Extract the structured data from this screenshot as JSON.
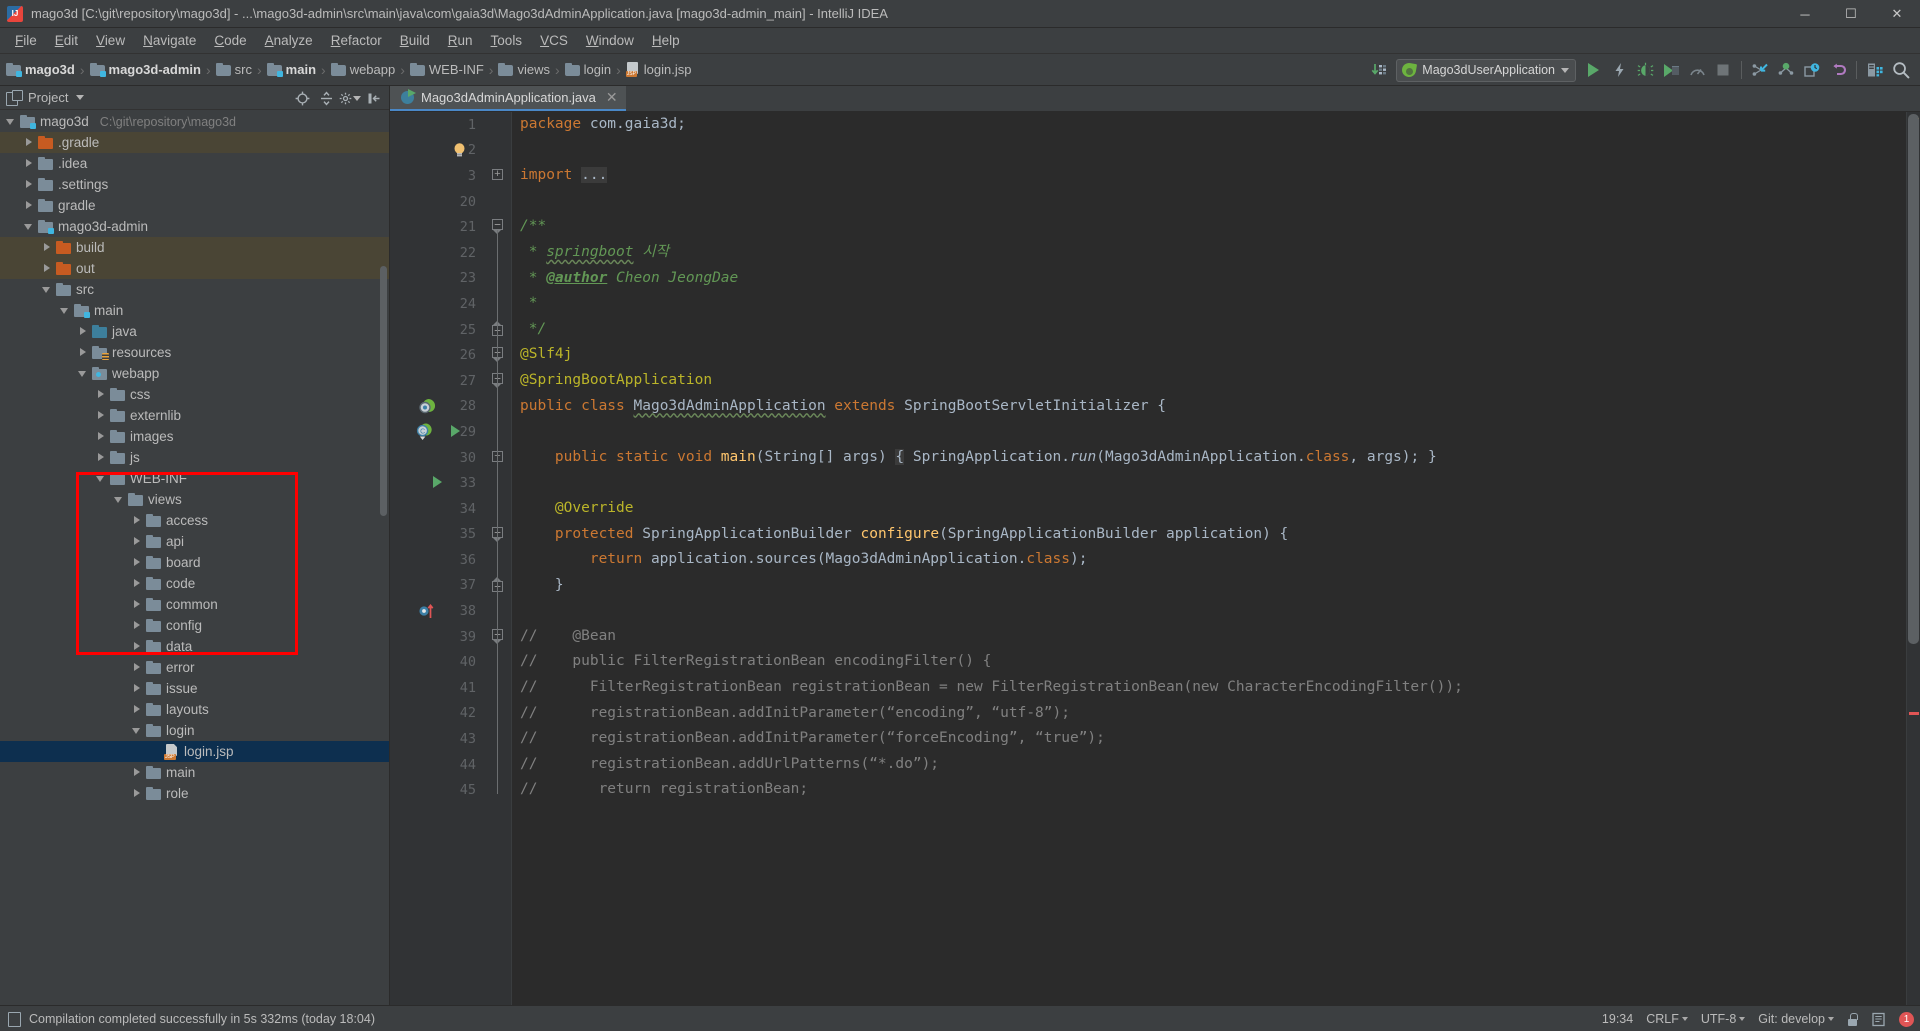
{
  "window": {
    "title": "mago3d [C:\\git\\repository\\mago3d] - ...\\mago3d-admin\\src\\main\\java\\com\\gaia3d\\Mago3dAdminApplication.java [mago3d-admin_main] - IntelliJ IDEA",
    "app_icon": "intellij-idea-icon",
    "minimize_label": "─",
    "maximize_label": "☐",
    "close_label": "✕"
  },
  "menubar": {
    "items": [
      {
        "label": "File"
      },
      {
        "label": "Edit"
      },
      {
        "label": "View"
      },
      {
        "label": "Navigate"
      },
      {
        "label": "Code"
      },
      {
        "label": "Analyze"
      },
      {
        "label": "Refactor"
      },
      {
        "label": "Build"
      },
      {
        "label": "Run"
      },
      {
        "label": "Tools"
      },
      {
        "label": "VCS"
      },
      {
        "label": "Window"
      },
      {
        "label": "Help"
      }
    ]
  },
  "navbar": {
    "breadcrumbs": [
      {
        "label": "mago3d",
        "icon": "module-folder-icon",
        "bold": true
      },
      {
        "label": "mago3d-admin",
        "icon": "module-folder-icon",
        "bold": true
      },
      {
        "label": "src",
        "icon": "folder-icon",
        "bold": false
      },
      {
        "label": "main",
        "icon": "module-folder-icon",
        "bold": true
      },
      {
        "label": "webapp",
        "icon": "web-folder-icon",
        "bold": false
      },
      {
        "label": "WEB-INF",
        "icon": "folder-icon",
        "bold": false
      },
      {
        "label": "views",
        "icon": "folder-icon",
        "bold": false
      },
      {
        "label": "login",
        "icon": "folder-icon",
        "bold": false
      },
      {
        "label": "login.jsp",
        "icon": "jsp-file-icon",
        "bold": false
      }
    ],
    "separator": "›",
    "run_config": {
      "label": "Mago3dUserApplication",
      "icon": "spring-leaf-icon",
      "dropdown_icon": "chevron-down-icon"
    },
    "actions": [
      {
        "name": "update-project-icon",
        "glyph": "↓"
      },
      {
        "name": "run-icon",
        "glyph": "▶"
      },
      {
        "name": "run-with-coverage-icon",
        "glyph": "⚡"
      },
      {
        "name": "debug-icon",
        "glyph": "🐞"
      },
      {
        "name": "run-coverage-icon",
        "glyph": "▶"
      },
      {
        "name": "profiler-icon",
        "glyph": "◔"
      },
      {
        "name": "stop-icon",
        "glyph": "■"
      },
      {
        "name": "vcs-update-icon",
        "glyph": "↙"
      },
      {
        "name": "vcs-commit-icon",
        "glyph": "✔"
      },
      {
        "name": "vcs-history-icon",
        "glyph": "◴"
      },
      {
        "name": "vcs-rollback-icon",
        "glyph": "↶"
      },
      {
        "name": "structure-icon",
        "glyph": "☷"
      },
      {
        "name": "search-everywhere-icon",
        "glyph": "🔍"
      }
    ]
  },
  "project_panel": {
    "title": "Project",
    "dropdown_icon": "chevron-down-icon",
    "header_actions": [
      {
        "name": "locate-file-icon",
        "glyph": "⊕"
      },
      {
        "name": "collapse-all-icon",
        "glyph": "⤓"
      },
      {
        "name": "settings-icon",
        "glyph": "⚙"
      },
      {
        "name": "hide-panel-icon",
        "glyph": "⇤"
      }
    ],
    "tree": [
      {
        "label": "mago3d",
        "path": "C:\\git\\repository\\mago3d",
        "indent": 0,
        "state": "open",
        "icon": "module-folder-icon",
        "style": "normal"
      },
      {
        "label": ".gradle",
        "indent": 1,
        "state": "closed",
        "icon": "excluded-folder-icon",
        "style": "excluded"
      },
      {
        "label": ".idea",
        "indent": 1,
        "state": "closed",
        "icon": "folder-icon",
        "style": "normal"
      },
      {
        "label": ".settings",
        "indent": 1,
        "state": "closed",
        "icon": "folder-icon",
        "style": "normal"
      },
      {
        "label": "gradle",
        "indent": 1,
        "state": "closed",
        "icon": "folder-icon",
        "style": "normal"
      },
      {
        "label": "mago3d-admin",
        "indent": 1,
        "state": "open",
        "icon": "module-folder-icon",
        "style": "normal"
      },
      {
        "label": "build",
        "indent": 2,
        "state": "closed",
        "icon": "excluded-folder-icon",
        "style": "excluded"
      },
      {
        "label": "out",
        "indent": 2,
        "state": "closed",
        "icon": "excluded-folder-icon",
        "style": "excluded"
      },
      {
        "label": "src",
        "indent": 2,
        "state": "open",
        "icon": "folder-icon",
        "style": "normal"
      },
      {
        "label": "main",
        "indent": 3,
        "state": "open",
        "icon": "module-folder-icon",
        "style": "normal"
      },
      {
        "label": "java",
        "indent": 4,
        "state": "closed",
        "icon": "source-folder-icon",
        "style": "normal"
      },
      {
        "label": "resources",
        "indent": 4,
        "state": "closed",
        "icon": "resource-folder-icon",
        "style": "normal"
      },
      {
        "label": "webapp",
        "indent": 4,
        "state": "open",
        "icon": "web-folder-icon",
        "style": "normal"
      },
      {
        "label": "css",
        "indent": 5,
        "state": "closed",
        "icon": "folder-icon",
        "style": "normal"
      },
      {
        "label": "externlib",
        "indent": 5,
        "state": "closed",
        "icon": "folder-icon",
        "style": "normal"
      },
      {
        "label": "images",
        "indent": 5,
        "state": "closed",
        "icon": "folder-icon",
        "style": "normal"
      },
      {
        "label": "js",
        "indent": 5,
        "state": "closed",
        "icon": "folder-icon",
        "style": "normal"
      },
      {
        "label": "WEB-INF",
        "indent": 5,
        "state": "open",
        "icon": "folder-icon",
        "style": "normal"
      },
      {
        "label": "views",
        "indent": 6,
        "state": "open",
        "icon": "folder-icon",
        "style": "normal"
      },
      {
        "label": "access",
        "indent": 7,
        "state": "closed",
        "icon": "folder-icon",
        "style": "normal"
      },
      {
        "label": "api",
        "indent": 7,
        "state": "closed",
        "icon": "folder-icon",
        "style": "normal"
      },
      {
        "label": "board",
        "indent": 7,
        "state": "closed",
        "icon": "folder-icon",
        "style": "normal"
      },
      {
        "label": "code",
        "indent": 7,
        "state": "closed",
        "icon": "folder-icon",
        "style": "normal"
      },
      {
        "label": "common",
        "indent": 7,
        "state": "closed",
        "icon": "folder-icon",
        "style": "normal"
      },
      {
        "label": "config",
        "indent": 7,
        "state": "closed",
        "icon": "folder-icon",
        "style": "normal"
      },
      {
        "label": "data",
        "indent": 7,
        "state": "closed",
        "icon": "folder-icon",
        "style": "normal"
      },
      {
        "label": "error",
        "indent": 7,
        "state": "closed",
        "icon": "folder-icon",
        "style": "normal"
      },
      {
        "label": "issue",
        "indent": 7,
        "state": "closed",
        "icon": "folder-icon",
        "style": "normal"
      },
      {
        "label": "layouts",
        "indent": 7,
        "state": "closed",
        "icon": "folder-icon",
        "style": "normal"
      },
      {
        "label": "login",
        "indent": 7,
        "state": "open",
        "icon": "folder-icon",
        "style": "normal"
      },
      {
        "label": "login.jsp",
        "indent": 8,
        "state": "leaf",
        "icon": "jsp-file-icon",
        "style": "selected"
      },
      {
        "label": "main",
        "indent": 7,
        "state": "closed",
        "icon": "folder-icon",
        "style": "normal"
      },
      {
        "label": "role",
        "indent": 7,
        "state": "closed",
        "icon": "folder-icon",
        "style": "normal"
      }
    ]
  },
  "editor": {
    "tabs": [
      {
        "label": "Mago3dAdminApplication.java",
        "icon": "java-class-runnable-icon",
        "close_icon": "close-icon",
        "active": true
      }
    ],
    "lines": [
      {
        "num": "1",
        "segs": [
          {
            "t": "package ",
            "c": "k"
          },
          {
            "t": "com",
            "c": "cls"
          },
          {
            "t": ".",
            "c": "cls"
          },
          {
            "t": "gaia3d",
            "c": "cls"
          },
          {
            "t": ";",
            "c": "cls"
          }
        ],
        "indent": 0
      },
      {
        "num": "2",
        "segs": [],
        "indent": 0,
        "marker": "intention-bulb-icon"
      },
      {
        "num": "3",
        "segs": [
          {
            "t": "import ",
            "c": "k"
          },
          {
            "t": "...",
            "c": "hl"
          }
        ],
        "indent": 0,
        "fold": "collapsed"
      },
      {
        "num": "20",
        "segs": [],
        "indent": 0
      },
      {
        "num": "21",
        "segs": [
          {
            "t": "/**",
            "c": "jd"
          }
        ],
        "indent": 0,
        "fold": "top"
      },
      {
        "num": "22",
        "segs": [
          {
            "t": " * ",
            "c": "jd"
          },
          {
            "t": "springboot",
            "c": "jdwav"
          },
          {
            "t": " 시작",
            "c": "jd"
          }
        ],
        "indent": 0
      },
      {
        "num": "23",
        "segs": [
          {
            "t": " * ",
            "c": "jd"
          },
          {
            "t": "@author",
            "c": "jdt"
          },
          {
            "t": " Cheon JeongDae",
            "c": "jd"
          }
        ],
        "indent": 0
      },
      {
        "num": "24",
        "segs": [
          {
            "t": " *",
            "c": "jd"
          }
        ],
        "indent": 0
      },
      {
        "num": "25",
        "segs": [
          {
            "t": " */",
            "c": "jd"
          }
        ],
        "indent": 0,
        "fold": "bottom"
      },
      {
        "num": "26",
        "segs": [
          {
            "t": "@Slf4j",
            "c": "ann"
          }
        ],
        "indent": 0,
        "fold": "top"
      },
      {
        "num": "27",
        "segs": [
          {
            "t": "@SpringBootApplication",
            "c": "ann"
          }
        ],
        "indent": 0,
        "fold": "top",
        "marker": "spring-bean-icon"
      },
      {
        "num": "28",
        "segs": [
          {
            "t": "public ",
            "c": "k"
          },
          {
            "t": "class ",
            "c": "k"
          },
          {
            "t": "Mago3dAdminApplication",
            "c": "clswav"
          },
          {
            "t": " ",
            "c": "cls"
          },
          {
            "t": "extends ",
            "c": "k"
          },
          {
            "t": "SpringBootServletInitializer",
            "c": "cls"
          },
          {
            "t": " {",
            "c": "cls"
          }
        ],
        "indent": 0,
        "marker": "spring-class-run-icon"
      },
      {
        "num": "29",
        "segs": [],
        "indent": 0
      },
      {
        "num": "30",
        "segs": [
          {
            "t": "    ",
            "c": "cls"
          },
          {
            "t": "public ",
            "c": "k"
          },
          {
            "t": "static ",
            "c": "k"
          },
          {
            "t": "void ",
            "c": "k"
          },
          {
            "t": "main",
            "c": "mth"
          },
          {
            "t": "(",
            "c": "cls"
          },
          {
            "t": "String",
            "c": "cls"
          },
          {
            "t": "[] args) ",
            "c": "cls"
          },
          {
            "t": "{",
            "c": "hl"
          },
          {
            "t": " SpringApplication.",
            "c": "cls"
          },
          {
            "t": "run",
            "c": "clsi"
          },
          {
            "t": "(Mago3dAdminApplication.",
            "c": "cls"
          },
          {
            "t": "class",
            "c": "k"
          },
          {
            "t": ", args)",
            "c": "cls"
          },
          {
            "t": ";",
            "c": "cls"
          },
          {
            "t": " }",
            "c": "cls"
          }
        ],
        "indent": 0,
        "fold": "collapsed",
        "marker": "run-method-icon"
      },
      {
        "num": "33",
        "segs": [],
        "indent": 0
      },
      {
        "num": "34",
        "segs": [
          {
            "t": "    ",
            "c": "cls"
          },
          {
            "t": "@Override",
            "c": "ann"
          }
        ],
        "indent": 0
      },
      {
        "num": "35",
        "segs": [
          {
            "t": "    ",
            "c": "cls"
          },
          {
            "t": "protected ",
            "c": "k"
          },
          {
            "t": "SpringApplicationBuilder ",
            "c": "cls"
          },
          {
            "t": "configure",
            "c": "mth"
          },
          {
            "t": "(SpringApplicationBuilder application) {",
            "c": "cls"
          }
        ],
        "indent": 0,
        "fold": "top",
        "marker": "override-method-icon"
      },
      {
        "num": "36",
        "segs": [
          {
            "t": "        ",
            "c": "cls"
          },
          {
            "t": "return ",
            "c": "k"
          },
          {
            "t": "application.sources(Mago3dAdminApplication.",
            "c": "cls"
          },
          {
            "t": "class",
            "c": "k"
          },
          {
            "t": ");",
            "c": "cls"
          }
        ],
        "indent": 0
      },
      {
        "num": "37",
        "segs": [
          {
            "t": "    }",
            "c": "cls"
          }
        ],
        "indent": 0,
        "fold": "bottom"
      },
      {
        "num": "38",
        "segs": [],
        "indent": 0
      },
      {
        "num": "39",
        "segs": [
          {
            "t": "//    @Bean",
            "c": "cm"
          }
        ],
        "indent": 0,
        "fold": "top"
      },
      {
        "num": "40",
        "segs": [
          {
            "t": "//    public FilterRegistrationBean encodingFilter() {",
            "c": "cm"
          }
        ],
        "indent": 0
      },
      {
        "num": "41",
        "segs": [
          {
            "t": "//      FilterRegistrationBean registrationBean = new FilterRegistrationBean(new CharacterEncodingFilter());",
            "c": "cm"
          }
        ],
        "indent": 0
      },
      {
        "num": "42",
        "segs": [
          {
            "t": "//      registrationBean.addInitParameter(“encoding”, “utf-8”);",
            "c": "cm"
          }
        ],
        "indent": 0
      },
      {
        "num": "43",
        "segs": [
          {
            "t": "//      registrationBean.addInitParameter(“forceEncoding”, “true”);",
            "c": "cm"
          }
        ],
        "indent": 0
      },
      {
        "num": "44",
        "segs": [
          {
            "t": "//      registrationBean.addUrlPatterns(“*.do”);",
            "c": "cm"
          }
        ],
        "indent": 0
      },
      {
        "num": "45",
        "segs": [
          {
            "t": "//       return registrationBean;",
            "c": "cm"
          }
        ],
        "indent": 0
      }
    ]
  },
  "statusbar": {
    "icon": "event-log-icon",
    "message": "Compilation completed successfully in 5s 332ms (today 18:04)",
    "caret_position": "19:34",
    "line_separator": "CRLF",
    "encoding": "UTF-8",
    "git_branch": "Git: develop",
    "lock_icon": "read-only-lock-icon",
    "inspection_icon": "inspections-icon",
    "error_count": "1"
  },
  "colors": {
    "panel_bg": "#3c3f41",
    "editor_bg": "#2b2b2b",
    "gutter_bg": "#313335",
    "keyword": "#cc7832",
    "comment": "#808080",
    "javadoc": "#629755",
    "annotation": "#bbb529",
    "method": "#ffc66d",
    "text": "#a9b7c6",
    "selection": "#0d2f4f",
    "excluded": "#4a4535",
    "tab_underline": "#4a88c7",
    "annotation_box": "#ff0000"
  }
}
